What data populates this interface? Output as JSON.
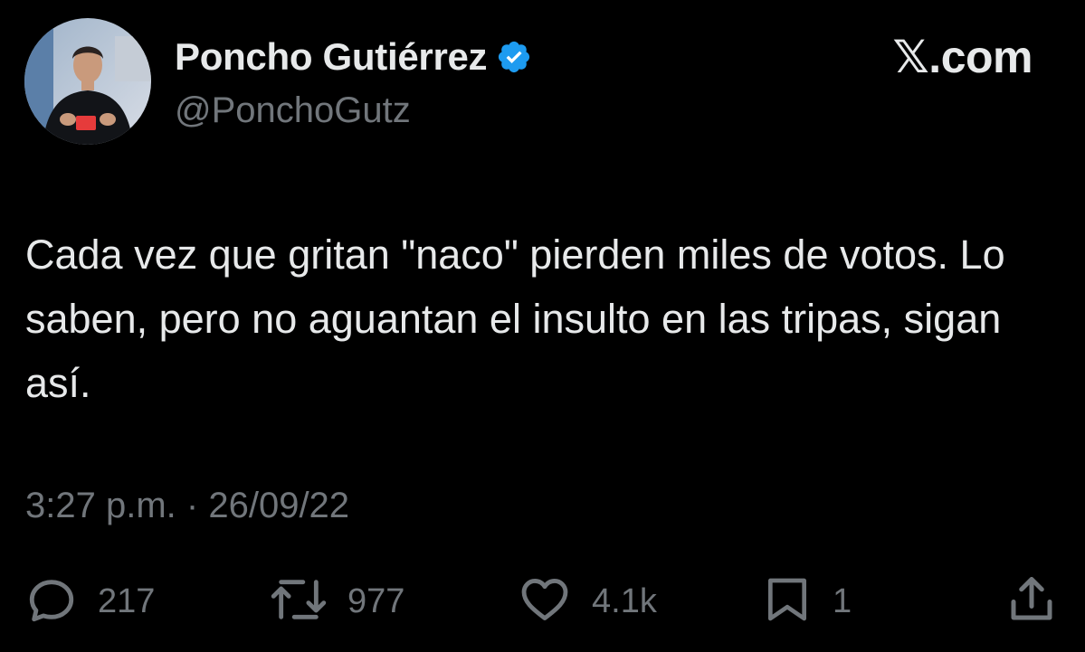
{
  "author": {
    "display_name": "Poncho Gutiérrez",
    "handle": "@PonchoGutz",
    "verified": true
  },
  "brand": {
    "mark": "𝕏",
    "suffix": ".com"
  },
  "tweet": {
    "text": "Cada vez que gritan \"naco\" pierden miles de votos. Lo saben, pero no aguantan el insulto en las tripas, sigan así.",
    "time": "3:27 p.m.",
    "separator": "·",
    "date": "26/09/22"
  },
  "actions": {
    "reply": {
      "icon": "reply-icon",
      "count": "217"
    },
    "retweet": {
      "icon": "retweet-icon",
      "count": "977"
    },
    "like": {
      "icon": "heart-icon",
      "count": "4.1k"
    },
    "bookmark": {
      "icon": "bookmark-icon",
      "count": "1"
    },
    "share": {
      "icon": "share-icon"
    }
  },
  "colors": {
    "background": "#000000",
    "primary_text": "#e7e9ea",
    "secondary_text": "#71767b",
    "verified_badge": "#1d9bf0"
  }
}
